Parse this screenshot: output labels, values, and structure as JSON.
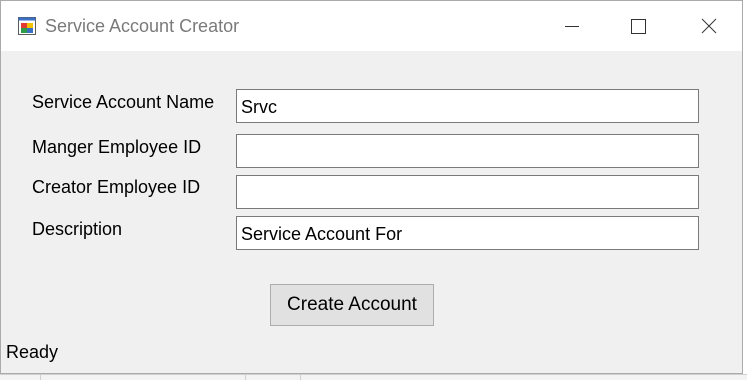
{
  "window": {
    "title": "Service Account Creator",
    "app_icon": "winforms-app-icon",
    "controls": {
      "minimize_icon": "minimize-icon",
      "maximize_icon": "maximize-icon",
      "close_icon": "close-icon"
    }
  },
  "form": {
    "fields": [
      {
        "label": "Service Account Name",
        "value": "Srvc"
      },
      {
        "label": "Manger Employee ID",
        "value": ""
      },
      {
        "label": "Creator Employee ID",
        "value": ""
      },
      {
        "label": "Description",
        "value": "Service Account For"
      }
    ],
    "submit_label": "Create Account"
  },
  "status": {
    "text": "Ready"
  },
  "colors": {
    "titlebar_bg": "#ffffff",
    "window_bg": "#f0f0f0",
    "button_bg": "#e1e1e1",
    "border": "#7a7a7a"
  }
}
